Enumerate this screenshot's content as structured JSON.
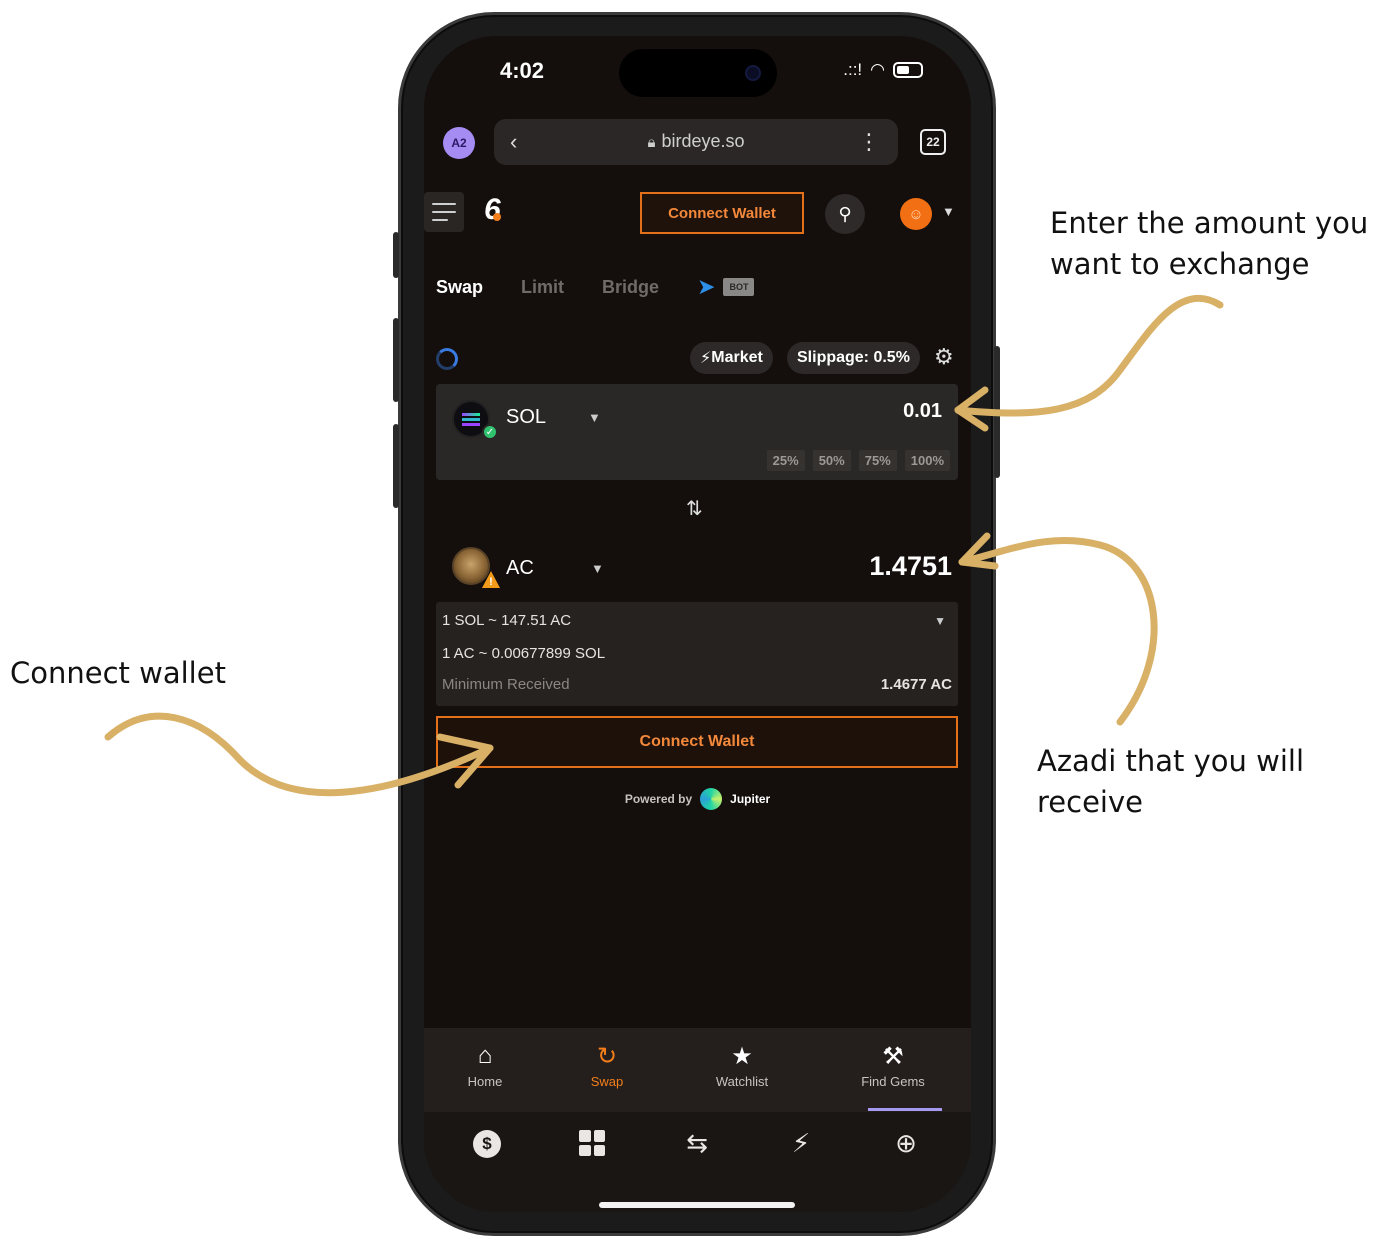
{
  "annotations": {
    "enter_amount": "Enter the amount you want to exchange",
    "connect_wallet": "Connect wallet",
    "azadi_receive": "Azadi that you will receive"
  },
  "status": {
    "time": "4:02",
    "signal": ".::!",
    "wifi": "wifi-icon",
    "battery": "battery-icon"
  },
  "browser": {
    "profile": "A2",
    "url": "birdeye.so",
    "tabs_count": "22"
  },
  "header": {
    "logo": "6",
    "connect_wallet": "Connect Wallet"
  },
  "trade_tabs": {
    "swap": "Swap",
    "limit": "Limit",
    "bridge": "Bridge",
    "bot_badge": "BOT"
  },
  "settings": {
    "market": "Market",
    "slippage": "Slippage: 0.5%"
  },
  "from": {
    "token": "SOL",
    "amount": "0.01",
    "percents": [
      "25%",
      "50%",
      "75%",
      "100%"
    ]
  },
  "to": {
    "token": "AC",
    "amount": "1.4751"
  },
  "rates": {
    "sol_to_ac": "1 SOL ~ 147.51 AC",
    "ac_to_sol": "1 AC ~ 0.00677899 SOL",
    "min_received_label": "Minimum Received",
    "min_received_value": "1.4677 AC"
  },
  "main_button": "Connect Wallet",
  "powered": {
    "label": "Powered by",
    "provider": "Jupiter"
  },
  "bottom_nav": {
    "home": "Home",
    "swap": "Swap",
    "watchlist": "Watchlist",
    "find_gems": "Find Gems"
  },
  "colors": {
    "accent_orange": "#f47e1a",
    "annotation_arrow": "#d8b066",
    "screen_bg": "#140f0d"
  }
}
